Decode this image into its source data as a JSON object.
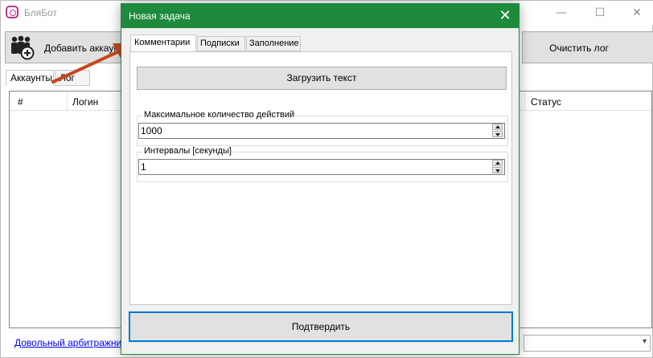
{
  "main": {
    "title": "БляБот",
    "window_controls": {
      "minimize": "—",
      "maximize": "☐",
      "close": "✕"
    },
    "toolbar": {
      "add_account_label": "Добавить аккаунт",
      "clear_log_label": "Очистить лог"
    },
    "tabs": [
      {
        "label": "Аккаунты"
      },
      {
        "label": "Лог"
      }
    ],
    "grid": {
      "columns": [
        {
          "label": "#"
        },
        {
          "label": "Логин"
        },
        {
          "label": "Статус"
        }
      ]
    },
    "status_link": "Довольный арбитражник",
    "combo_arrow": "▾"
  },
  "dialog": {
    "title": "Новая задача",
    "close_glyph": "✕",
    "tabs": [
      {
        "label": "Комментарии"
      },
      {
        "label": "Подписки"
      },
      {
        "label": "Заполнение"
      }
    ],
    "load_text_label": "Загрузить текст",
    "max_actions": {
      "legend": "Максимальное количество действий",
      "value": "1000"
    },
    "intervals": {
      "legend": "Интервалы [секунды]",
      "value": "1"
    },
    "confirm_label": "Подтвердить"
  },
  "colors": {
    "dialog_accent": "#1e8a3d",
    "focus_border": "#0078d7",
    "arrow": "#c8461c",
    "link": "#0000ee"
  }
}
